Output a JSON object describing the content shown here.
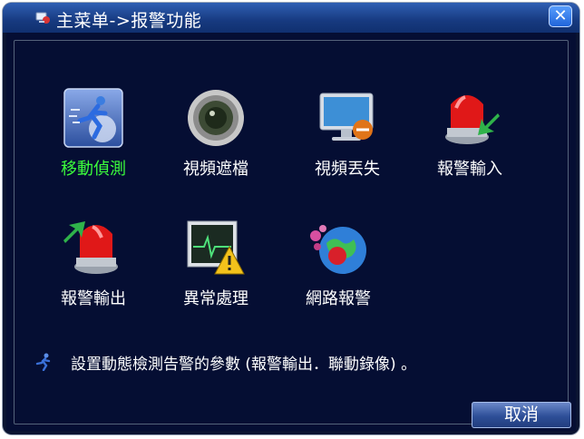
{
  "window": {
    "title": "主菜单->报警功能",
    "close_glyph": "✕"
  },
  "menu_items": [
    {
      "label": "移動偵測",
      "icon": "motion-detect-icon",
      "selected": true
    },
    {
      "label": "視頻遮檔",
      "icon": "video-blind-icon",
      "selected": false
    },
    {
      "label": "視頻丟失",
      "icon": "video-loss-icon",
      "selected": false
    },
    {
      "label": "報警輸入",
      "icon": "alarm-input-icon",
      "selected": false
    },
    {
      "label": "報警輸出",
      "icon": "alarm-output-icon",
      "selected": false
    },
    {
      "label": "異常處理",
      "icon": "abnormality-icon",
      "selected": false
    },
    {
      "label": "網路報警",
      "icon": "network-alarm-icon",
      "selected": false
    }
  ],
  "hint": {
    "text": "設置動態檢測告警的參數 (報警輸出．聯動錄像) 。",
    "icon": "running-man-icon"
  },
  "buttons": {
    "cancel": "取消"
  },
  "colors": {
    "selected_label": "#3cff3c",
    "background": "#050e33",
    "title_bar": "#1d4590"
  }
}
